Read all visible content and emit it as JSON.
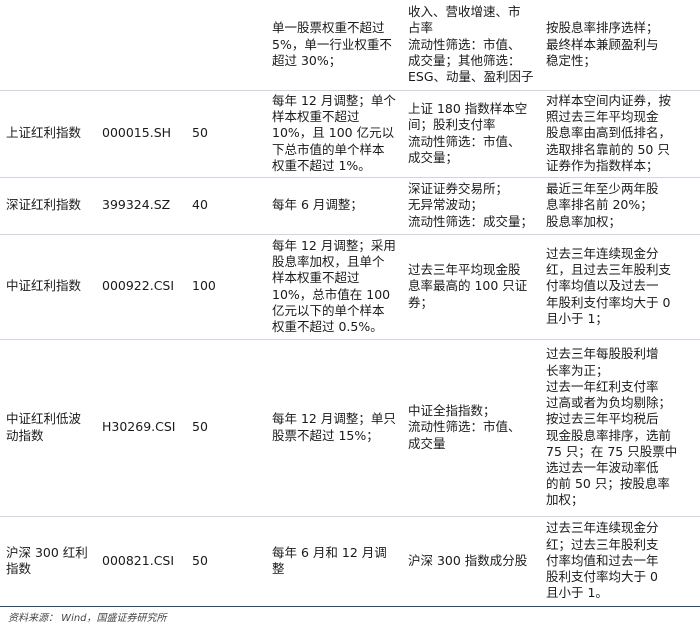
{
  "rows": [
    {
      "name": "",
      "code": "",
      "count": "",
      "weight": "单一股票权重不超过\n5%，单一行业权重不\n超过 30%；",
      "space": "收入、营收增速、市\n占率\n流动性筛选：市值、\n成交量；其他筛选：\nESG、动量、盈利因子",
      "method": "按股息率排序选样；\n最终样本兼顾盈利与\n稳定性；"
    },
    {
      "name": "上证红利指数",
      "code": "000015.SH",
      "count": "50",
      "weight": "每年 12 月调整；单个\n样本权重不超过\n10%，且 100 亿元以\n下总市值的单个样本\n权重不超过 1%。",
      "space": "上证 180 指数样本空\n间；股利支付率\n流动性筛选：市值、\n成交量；",
      "method": "对样本空间内证券，按\n照过去三年平均现金\n股息率由高到低排名，\n选取排名靠前的 50 只\n证券作为指数样本；"
    },
    {
      "name": "深证红利指数",
      "code": "399324.SZ",
      "count": "40",
      "weight": "每年 6 月调整；",
      "space": "深证证券交易所；\n无异常波动；\n流动性筛选：成交量；",
      "method": "最近三年至少两年股\n息率排名前 20%；\n股息率加权；"
    },
    {
      "name": "中证红利指数",
      "code": "000922.CSI",
      "count": "100",
      "weight": "每年 12 月调整；采用\n股息率加权，且单个\n样本权重不超过\n10%，总市值在 100\n亿元以下的单个样本\n权重不超过 0.5%。",
      "space": "过去三年平均现金股\n息率最高的 100 只证\n券；",
      "method": "过去三年连续现金分\n红，且过去三年股利支\n付率均值以及过去一\n年股利支付率均大于 0\n且小于 1；"
    },
    {
      "name": "中证红利低波\n动指数",
      "code": "H30269.CSI",
      "count": "50",
      "weight": "每年 12 月调整；单只\n股票不超过 15%；",
      "space": "中证全指指数；\n流动性筛选：市值、\n成交量",
      "method": "过去三年每股股利增\n长率为正；\n过去一年红利支付率\n过高或者为负均剔除；\n按过去三年平均税后\n现金股息率排序，选前\n75 只；在 75 只股票中\n选过去一年波动率低\n的前 50 只；按股息率\n加权；"
    },
    {
      "name": "沪深 300 红利\n指数",
      "code": "000821.CSI",
      "count": "50",
      "weight": "每年 6 月和 12 月调\n整",
      "space": "沪深 300 指数成分股",
      "method": "过去三年连续现金分\n红；过去三年股利支\n付率均值和过去一年\n股利支付率均大于 0\n且小于 1。"
    }
  ],
  "source": "资料来源： Wind，国盛证券研究所"
}
